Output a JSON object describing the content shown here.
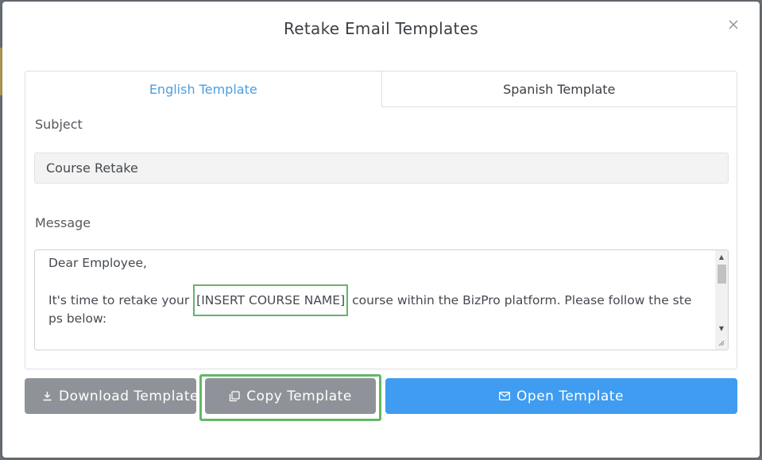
{
  "modal": {
    "title": "Retake Email Templates",
    "close_icon": "close-icon"
  },
  "tabs": [
    {
      "label": "English Template",
      "active": true
    },
    {
      "label": "Spanish Template",
      "active": false
    }
  ],
  "form": {
    "subject_label": "Subject",
    "subject_value": "Course Retake",
    "message_label": "Message",
    "message": {
      "greeting": "Dear Employee,",
      "line1_before": "It's time to retake your ",
      "placeholder": "[INSERT COURSE NAME]",
      "line1_after": " course within the BizPro platform. Please follow the ste ps below:"
    }
  },
  "buttons": {
    "download_label": "Download Template",
    "copy_label": "Copy Template",
    "open_label": "Open Template"
  },
  "colors": {
    "accent": "#3f9cf0",
    "tab_active": "#4a9fe0",
    "secondary_button": "#8f9399",
    "highlight_border": "#62b865"
  }
}
